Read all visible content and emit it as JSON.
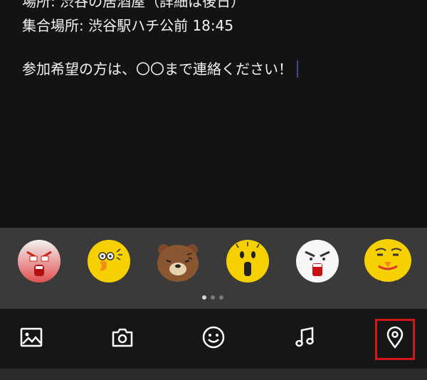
{
  "editor": {
    "line1": "場所: 渋谷の居酒屋（詳細は後日）",
    "line2": "集合場所: 渋谷駅ハチ公前 18:45",
    "line3": "参加希望の方は、〇〇まで連絡ください！"
  },
  "stickers": {
    "items": [
      "angry-face-sticker",
      "sally-chick-sticker",
      "brown-bear-sticker",
      "shocked-yellow-sticker",
      "angry-white-sticker",
      "smug-yellow-sticker"
    ],
    "page_count": 3,
    "active_page": 1
  },
  "toolbar": {
    "icons": [
      "image-icon",
      "camera-icon",
      "smiley-icon",
      "music-note-icon",
      "location-pin-icon"
    ],
    "highlighted": "location-pin-icon"
  },
  "colors": {
    "background": "#131313",
    "sticker_bar": "#3a3a3a",
    "caret": "#3d4a93",
    "highlight": "#d01818"
  }
}
